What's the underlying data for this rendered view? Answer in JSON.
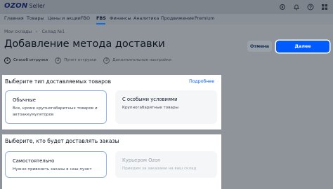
{
  "header": {
    "logo_main": "OZON",
    "logo_sub": "Seller",
    "icons": [
      "settings-icon",
      "bell-icon",
      "help-icon",
      "apps-icon"
    ]
  },
  "nav": {
    "items": [
      "Главная",
      "Товары",
      "Цены и акции",
      "FBO",
      "FBS",
      "Финансы",
      "Аналитика",
      "Продвижение",
      "Premium"
    ],
    "active": "FBS"
  },
  "breadcrumb": {
    "items": [
      "Мои склады",
      "Склад №1"
    ],
    "separator": "›"
  },
  "page": {
    "title": "Добавление метода доставки",
    "cancel_label": "Отмена",
    "next_label": "Далее"
  },
  "steps": [
    {
      "num": "1",
      "label": "Способ отгрузки",
      "active": true
    },
    {
      "num": "2",
      "label": "Пункт отгрузки",
      "active": false
    },
    {
      "num": "3",
      "label": "Дополнительные настройки",
      "active": false
    }
  ],
  "section_goods": {
    "title": "Выберите тип доставляемых товаров",
    "link": "Подробнее",
    "options": [
      {
        "title": "Обычные",
        "desc": "Все, кроме крупногабаритных товаров и автоаккумуляторов",
        "selected": true
      },
      {
        "title": "С особыми условиями",
        "desc": "Крупногабаритные товары",
        "selected": false
      }
    ]
  },
  "section_delivery": {
    "title": "Выберите, кто будет доставлять заказы",
    "options": [
      {
        "title": "Самостоятельно",
        "desc": "Нужно привозить заказы в наш пункт",
        "selected": true
      },
      {
        "title": "Курьером Ozon",
        "desc": "Приедем за заказами на ваш склад",
        "disabled": true
      }
    ]
  },
  "colors": {
    "accent": "#005bff",
    "overlay_bg": "#8f949b",
    "card_bg": "#ffffff"
  }
}
